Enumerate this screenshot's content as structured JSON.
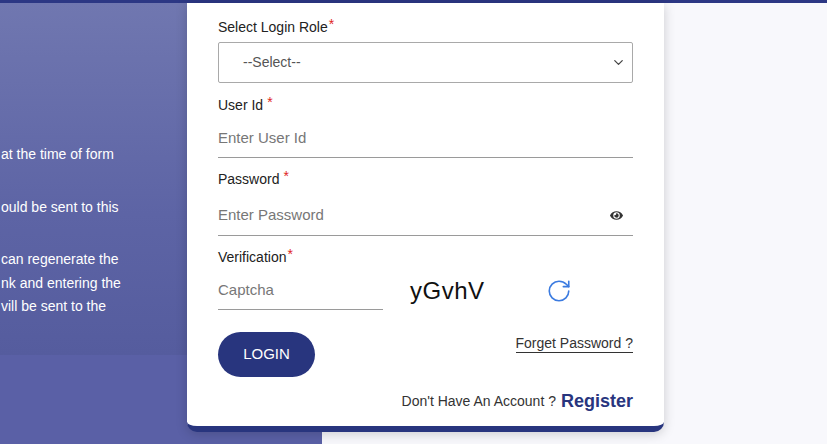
{
  "background_text": [
    [
      "at the time of form"
    ],
    [
      "ould be sent to this"
    ],
    [
      "can regenerate the",
      "nk and entering the",
      "vill be sent to the"
    ]
  ],
  "form": {
    "role": {
      "label": "Select Login Role",
      "mark": "*",
      "placeholder": "--Select--"
    },
    "user_id": {
      "label": "User Id",
      "mark": "*",
      "placeholder": "Enter User Id"
    },
    "password": {
      "label": "Password",
      "mark": "*",
      "placeholder": "Enter Password"
    },
    "verification": {
      "label": "Verification",
      "mark": "*",
      "placeholder": "Captcha",
      "code": "yGvhV"
    },
    "login_button": "LOGIN",
    "forget_link": "Forget Password ?",
    "register_prompt": "Don't Have An Account ?",
    "register_link": "Register"
  }
}
